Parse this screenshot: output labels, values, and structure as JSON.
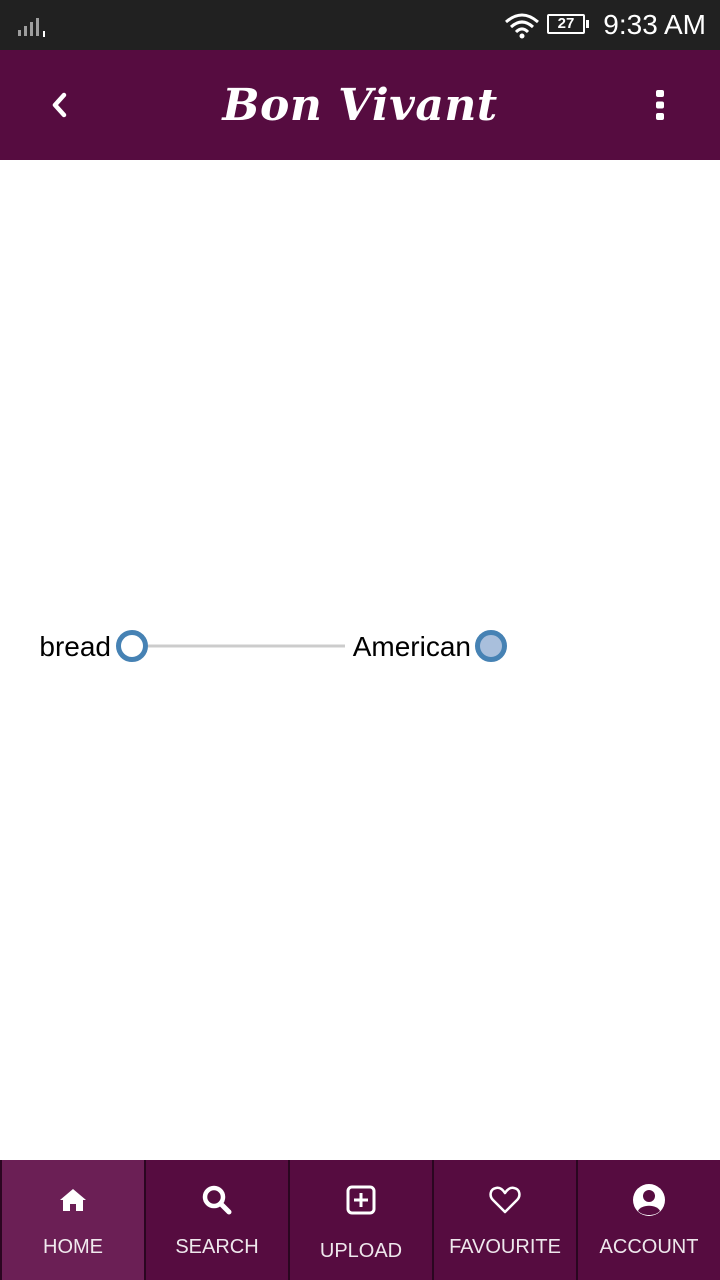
{
  "status_bar": {
    "battery_level": "27",
    "time": "9:33 AM",
    "icons": [
      "signal-icon",
      "wifi-icon",
      "battery-icon"
    ]
  },
  "app_bar": {
    "title": "Bon Vivant",
    "back_icon": "chevron-left-icon",
    "menu_icon": "more-vertical-icon",
    "color": "#560c40"
  },
  "graph": {
    "nodes": [
      {
        "id": "bread",
        "label": "bread"
      },
      {
        "id": "american",
        "label": "American"
      }
    ],
    "edges": [
      {
        "from": "bread",
        "to": "american"
      }
    ],
    "node_stroke_color": "#4682b4",
    "selected_node_fill": "#a9bfdc"
  },
  "bottom_nav": {
    "items": [
      {
        "label": "HOME",
        "icon": "home-icon",
        "active": true
      },
      {
        "label": "SEARCH",
        "icon": "search-icon",
        "active": false
      },
      {
        "label": "UPLOAD",
        "icon": "add-box-icon",
        "active": false
      },
      {
        "label": "FAVOURITE",
        "icon": "heart-icon",
        "active": false
      },
      {
        "label": "ACCOUNT",
        "icon": "account-icon",
        "active": false
      }
    ]
  }
}
